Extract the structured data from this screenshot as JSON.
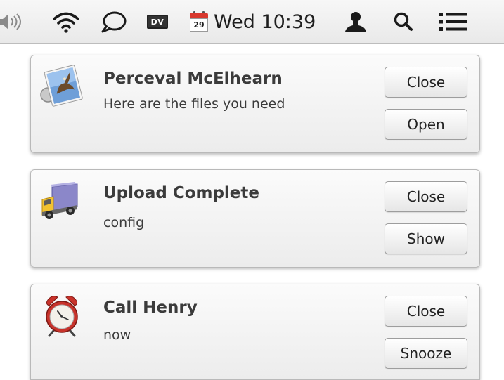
{
  "menubar": {
    "icons": {
      "volume": "speaker-volume-icon",
      "wifi": "wifi-signal-icon",
      "chat": "speech-bubble-icon",
      "dv": "dv-badge-icon",
      "calendar": "calendar-icon",
      "user": "user-silhouette-icon",
      "search": "spotlight-search-icon",
      "list": "notification-list-icon"
    },
    "dv_label": "DV",
    "calendar_day": "29",
    "clock": "Wed 10:39"
  },
  "notifications": [
    {
      "icon": "mail-stamp-eagle-icon",
      "title": "Perceval McElhearn",
      "body": "Here are the files you need",
      "buttons": [
        "Close",
        "Open"
      ]
    },
    {
      "icon": "delivery-truck-icon",
      "title": "Upload Complete",
      "body": "config",
      "buttons": [
        "Close",
        "Show"
      ]
    },
    {
      "icon": "alarm-clock-icon",
      "title": "Call Henry",
      "body": "now",
      "buttons": [
        "Close",
        "Snooze"
      ]
    }
  ],
  "colors": {
    "calendar_red": "#d8382e",
    "panel_border": "#b9b9b9",
    "text": "#3b3b3b"
  }
}
